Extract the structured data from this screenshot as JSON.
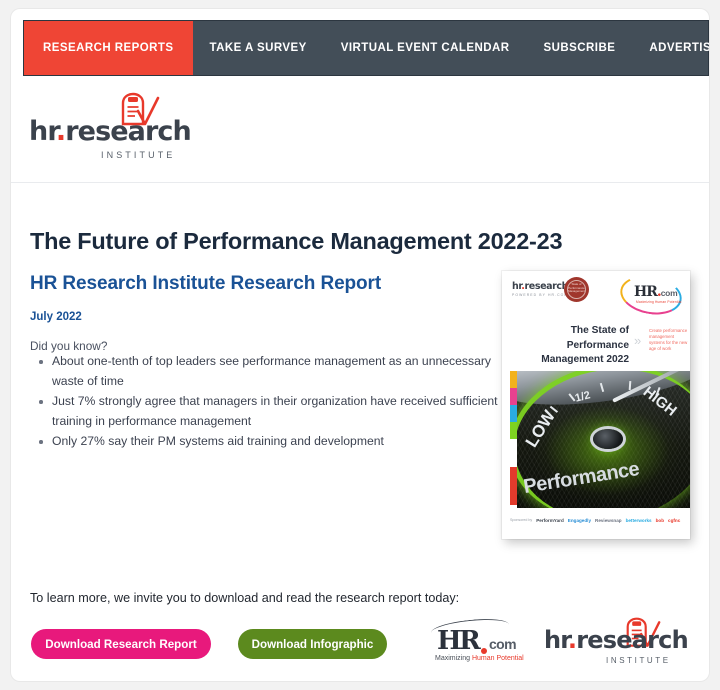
{
  "nav": {
    "items": [
      {
        "label": "RESEARCH REPORTS",
        "active": true
      },
      {
        "label": "TAKE A SURVEY",
        "active": false
      },
      {
        "label": "VIRTUAL EVENT CALENDAR",
        "active": false
      },
      {
        "label": "SUBSCRIBE",
        "active": false
      },
      {
        "label": "ADVERTISE",
        "active": false
      }
    ],
    "active_color": "#ef4535",
    "bar_color": "#434e58"
  },
  "brand": {
    "logo_word_1": "hr",
    "logo_dot": ".",
    "logo_word_2": "research",
    "logo_sub": "INSTITUTE",
    "mark_icon": "clipboard-checkmark-icon",
    "accent_color": "#e8392b"
  },
  "report": {
    "title": "The Future of Performance Management 2022-23",
    "subtitle": "HR Research Institute Research Report",
    "date": "July 2022",
    "intro": "Did you know?",
    "facts": [
      "About one-tenth of top leaders see performance management as an unnecessary waste of time",
      "Just 7% strongly agree that managers in their organization have received sufficient training in performance management",
      "Only 27% say their PM systems aid training and development"
    ],
    "subtitle_color": "#1a5296"
  },
  "cover": {
    "brand_word_1": "hr",
    "brand_dot": ".",
    "brand_word_2": "research",
    "brand_sub": "POWERED BY HR.COM",
    "seal_text": "State of Performance Management",
    "hrcom_hr": "HR",
    "hrcom_dot": ".",
    "hrcom_com": "com",
    "hrcom_tagline": "Maximizing Human Potential",
    "title": "The State of Performance Management 2022",
    "chevron": "»",
    "tagline": "Create performance management systems for the new age of work",
    "gauge_low": "LOW",
    "gauge_half": "1/2",
    "gauge_high": "HIGH",
    "gauge_word": "Performance",
    "sponsor_prefix": "Sponsored by",
    "sponsors": [
      "PerformYard",
      "Engagedly",
      "Reviewsnap",
      "betterworks",
      "bob",
      "cgfnc"
    ]
  },
  "cta": {
    "text": "To learn more, we invite you to download and read the research report today:",
    "primary_label": "Download Research Report",
    "primary_color": "#e8197c",
    "secondary_label": "Download Infographic",
    "secondary_color": "#5c8a1e"
  },
  "footer": {
    "hrcom_hr": "HR",
    "hrcom_com": "com",
    "hrcom_tag_1": "Maximizing ",
    "hrcom_tag_2": "Human Potential",
    "hrres_word_1": "hr",
    "hrres_dot": ".",
    "hrres_word_2": "research",
    "hrres_sub": "INSTITUTE",
    "mark_icon": "clipboard-checkmark-icon"
  }
}
